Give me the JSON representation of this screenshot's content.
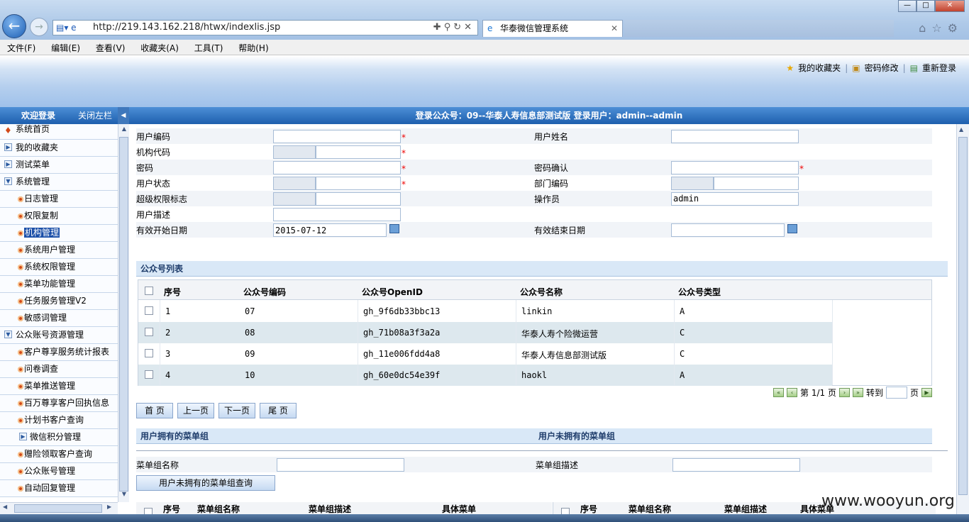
{
  "browser": {
    "url": "http://219.143.162.218/htwx/indexlis.jsp",
    "tab_title": "华泰微信管理系统"
  },
  "menubar": [
    "文件(F)",
    "编辑(E)",
    "查看(V)",
    "收藏夹(A)",
    "工具(T)",
    "帮助(H)"
  ],
  "header_links": {
    "favorites": "我的收藏夹",
    "change_password": "密码修改",
    "relogin": "重新登录"
  },
  "sidebar": {
    "title": "欢迎登录",
    "close_left": "关闭左栏",
    "items": [
      {
        "label": "系统首页"
      },
      {
        "label": "我的收藏夹"
      },
      {
        "label": "测试菜单"
      },
      {
        "label": "系统管理"
      },
      {
        "label": "日志管理"
      },
      {
        "label": "权限复制"
      },
      {
        "label": "机构管理"
      },
      {
        "label": "系统用户管理"
      },
      {
        "label": "系统权限管理"
      },
      {
        "label": "菜单功能管理"
      },
      {
        "label": "任务服务管理V2"
      },
      {
        "label": "敏感词管理"
      },
      {
        "label": "公众账号资源管理"
      },
      {
        "label": "客户尊享服务统计报表"
      },
      {
        "label": "问卷调查"
      },
      {
        "label": "菜单推送管理"
      },
      {
        "label": "百万尊享客户回执信息"
      },
      {
        "label": "计划书客户查询"
      },
      {
        "label": "微信积分管理"
      },
      {
        "label": "赠险领取客户查询"
      },
      {
        "label": "公众账号管理"
      },
      {
        "label": "自动回复管理"
      }
    ]
  },
  "topbar": {
    "text": "登录公众号：09--华泰人寿信息部测试版 登录用户：admin--admin"
  },
  "form": {
    "user_code": "用户编码",
    "user_name": "用户姓名",
    "org_code": "机构代码",
    "password": "密码",
    "password_confirm": "密码确认",
    "user_status": "用户状态",
    "dept_code": "部门编码",
    "super_flag": "超级权限标志",
    "operator": "操作员",
    "operator_value": "admin",
    "user_desc": "用户描述",
    "start_date": "有效开始日期",
    "start_date_value": "2015-07-12",
    "end_date": "有效结束日期",
    "required_mark": "*"
  },
  "account_list": {
    "title": "公众号列表",
    "columns": [
      "序号",
      "公众号编码",
      "公众号OpenID",
      "公众号名称",
      "公众号类型"
    ],
    "rows": [
      {
        "no": "1",
        "code": "07",
        "openid": "gh_9f6db33bbc13",
        "name": "linkin",
        "type": "A"
      },
      {
        "no": "2",
        "code": "08",
        "openid": "gh_71b08a3f3a2a",
        "name": "华泰人寿个险微运营",
        "type": "C"
      },
      {
        "no": "3",
        "code": "09",
        "openid": "gh_11e006fdd4a8",
        "name": "华泰人寿信息部测试版",
        "type": "C"
      },
      {
        "no": "4",
        "code": "10",
        "openid": "gh_60e0dc54e39f",
        "name": "haokl",
        "type": "A"
      }
    ]
  },
  "pager": {
    "page_text": "第 1/1 页",
    "goto": "转到",
    "page_unit": "页"
  },
  "nav_buttons": {
    "first": "首 页",
    "prev": "上一页",
    "next": "下一页",
    "last": "尾 页"
  },
  "menu_groups": {
    "owned_title": "用户拥有的菜单组",
    "not_owned_title": "用户未拥有的菜单组",
    "group_name_label": "菜单组名称",
    "group_desc_label": "菜单组描述",
    "query_button": "用户未拥有的菜单组查询",
    "columns": [
      "序号",
      "菜单组名称",
      "菜单组描述",
      "具体菜单"
    ]
  },
  "watermark": "www.wooyun.org",
  "colors": {
    "accent": "#1e5fae",
    "header_bg": "#b5cfee",
    "row_alt": "#dde8ee"
  }
}
